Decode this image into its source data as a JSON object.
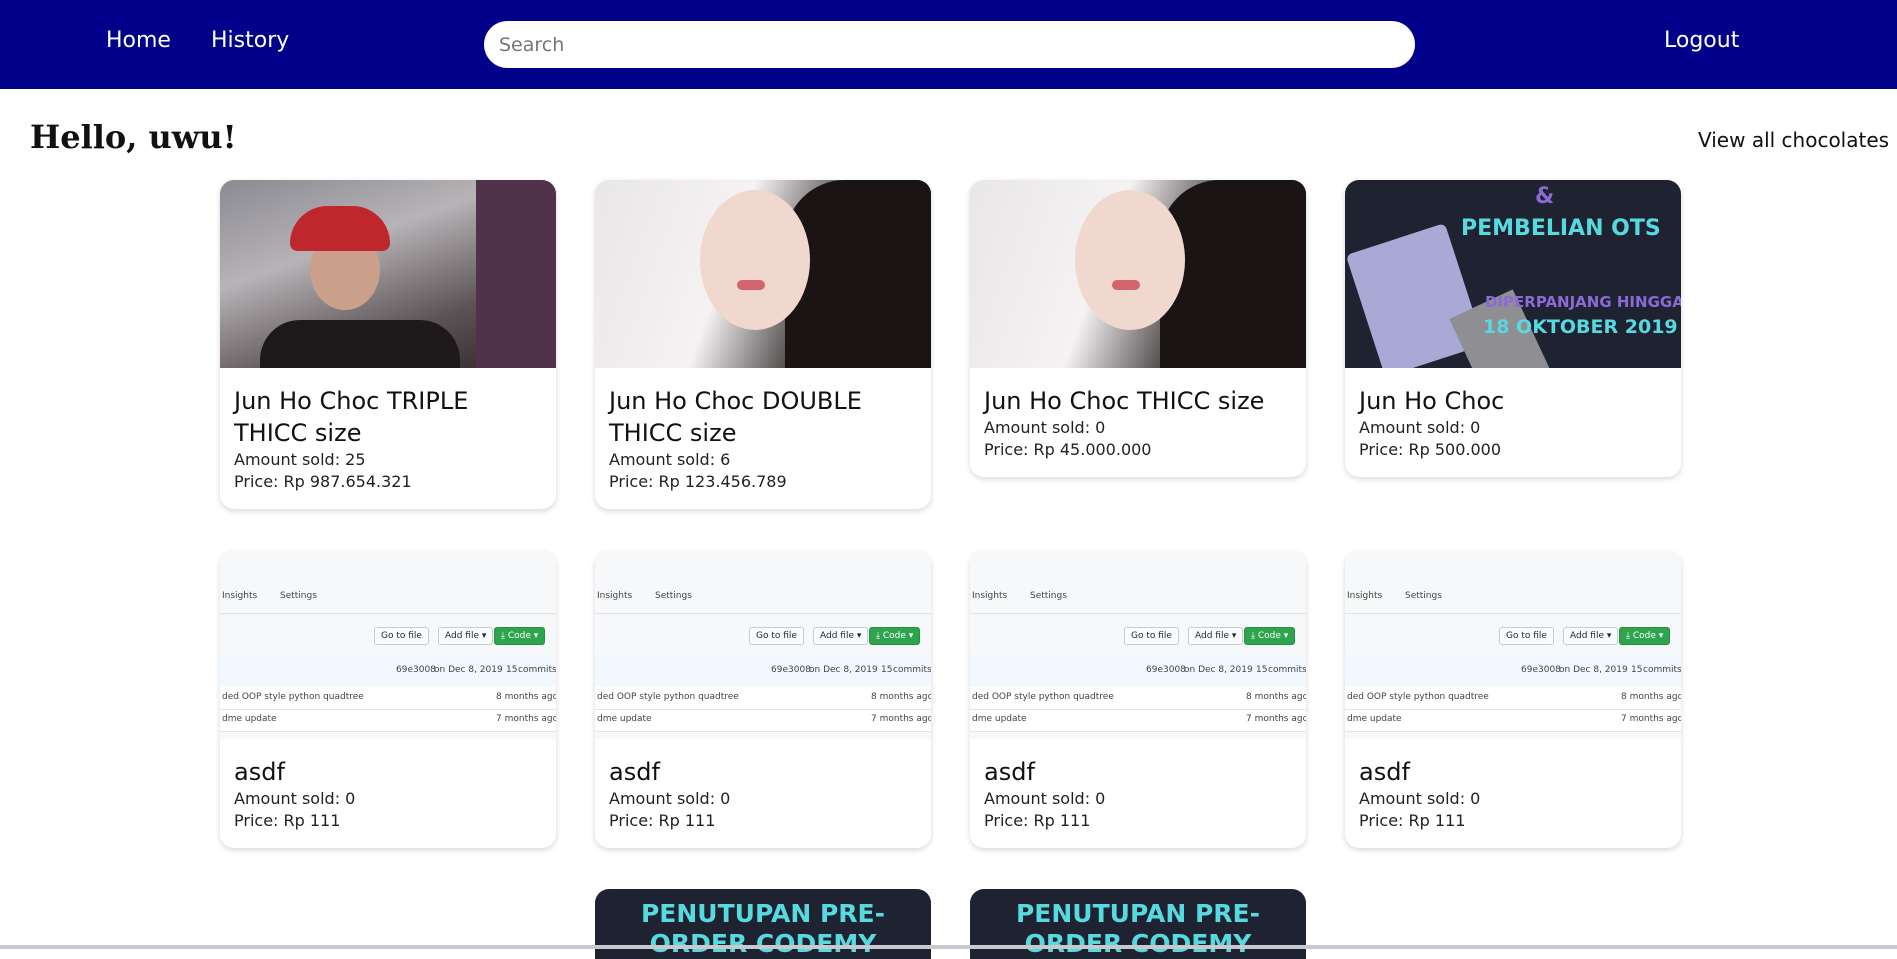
{
  "nav": {
    "home": "Home",
    "history": "History",
    "search_placeholder": "Search",
    "logout": "Logout"
  },
  "header": {
    "greeting": "Hello, uwu!",
    "view_all": "View all chocolates"
  },
  "cards": [
    {
      "title": "Jun Ho Choc TRIPLE THICC size",
      "amount": "Amount sold: 25",
      "price": "Price: Rp 987.654.321",
      "image": "photo-person"
    },
    {
      "title": "Jun Ho Choc DOUBLE THICC size",
      "amount": "Amount sold: 6",
      "price": "Price: Rp 123.456.789",
      "image": "photo-portrait"
    },
    {
      "title": "Jun Ho Choc THICC size",
      "amount": "Amount sold: 0",
      "price": "Price: Rp 45.000.000",
      "image": "photo-portrait"
    },
    {
      "title": "Jun Ho Choc",
      "amount": "Amount sold: 0",
      "price": "Price: Rp 500.000",
      "image": "poster"
    },
    {
      "title": "asdf",
      "amount": "Amount sold: 0",
      "price": "Price: Rp 111",
      "image": "github-screenshot"
    },
    {
      "title": "asdf",
      "amount": "Amount sold: 0",
      "price": "Price: Rp 111",
      "image": "github-screenshot"
    },
    {
      "title": "asdf",
      "amount": "Amount sold: 0",
      "price": "Price: Rp 111",
      "image": "github-screenshot"
    },
    {
      "title": "asdf",
      "amount": "Amount sold: 0",
      "price": "Price: Rp 111",
      "image": "github-screenshot"
    }
  ],
  "poster_text": {
    "line1": "&",
    "line2": "PEMBELIAN OTS",
    "line3": "DIPERPANJANG HINGGA",
    "line4": "18 OKTOBER 2019"
  },
  "github_text": {
    "insights": "Insights",
    "settings": "Settings",
    "go_to_file": "Go to file",
    "add_file": "Add file ▾",
    "code": "⤓ Code ▾",
    "commit_hash": "69e3008",
    "commit_date": "on Dec 8, 2019",
    "commits_count": "15",
    "commits_label": "commits",
    "row1_msg": "ded OOP style python quadtree",
    "row1_age": "8 months ago",
    "row2_msg": "dme update",
    "row2_age": "7 months ago"
  },
  "partial_cards": [
    {
      "text": "PENUTUPAN PRE-ORDER CODEMY"
    },
    {
      "text": "PENUTUPAN PRE-ORDER CODEMY"
    }
  ],
  "colors": {
    "navbar": "#00008b",
    "poster_bg": "#1f2331",
    "poster_cyan": "#57d9e0",
    "poster_purple": "#8b6ad6"
  }
}
